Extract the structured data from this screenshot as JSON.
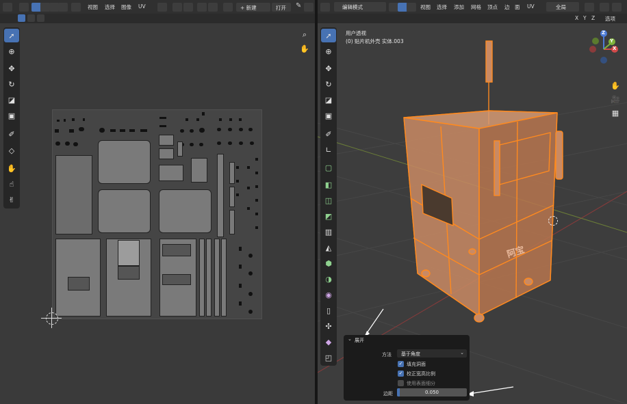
{
  "uv_editor": {
    "menus": [
      "视图",
      "选择",
      "图像",
      "UV"
    ],
    "new_label": "+ 新建",
    "open_label": "打开"
  },
  "viewport": {
    "mode": "编辑模式",
    "menus": [
      "视图",
      "选择",
      "添加",
      "网格",
      "顶点",
      "边",
      "面",
      "UV"
    ],
    "orientation": "全局",
    "axis_x": "X",
    "axis_y": "Y",
    "axis_z": "Z",
    "options_label": "选项",
    "overlay_line1": "用户透视",
    "overlay_line2": "(0) 贴片机外壳 实体.003",
    "logo_text": "阿宝"
  },
  "gizmo": {
    "x": "X",
    "y": "Y",
    "z": "Z"
  },
  "operator_panel": {
    "title": "展开",
    "method_label": "方法",
    "method_value": "基于角度",
    "fill_holes_label": "填充洞面",
    "fill_holes_checked": true,
    "correct_aspect_label": "校正宽高比例",
    "correct_aspect_checked": true,
    "use_subsurf_label": "使用表面细分",
    "use_subsurf_checked": false,
    "margin_label": "边距",
    "margin_value": "0.050"
  },
  "colors": {
    "accent": "#4772b3",
    "selection": "#ff8a1f",
    "mesh_fill": "#c98a64",
    "panel_bg": "#1b1b1b"
  }
}
